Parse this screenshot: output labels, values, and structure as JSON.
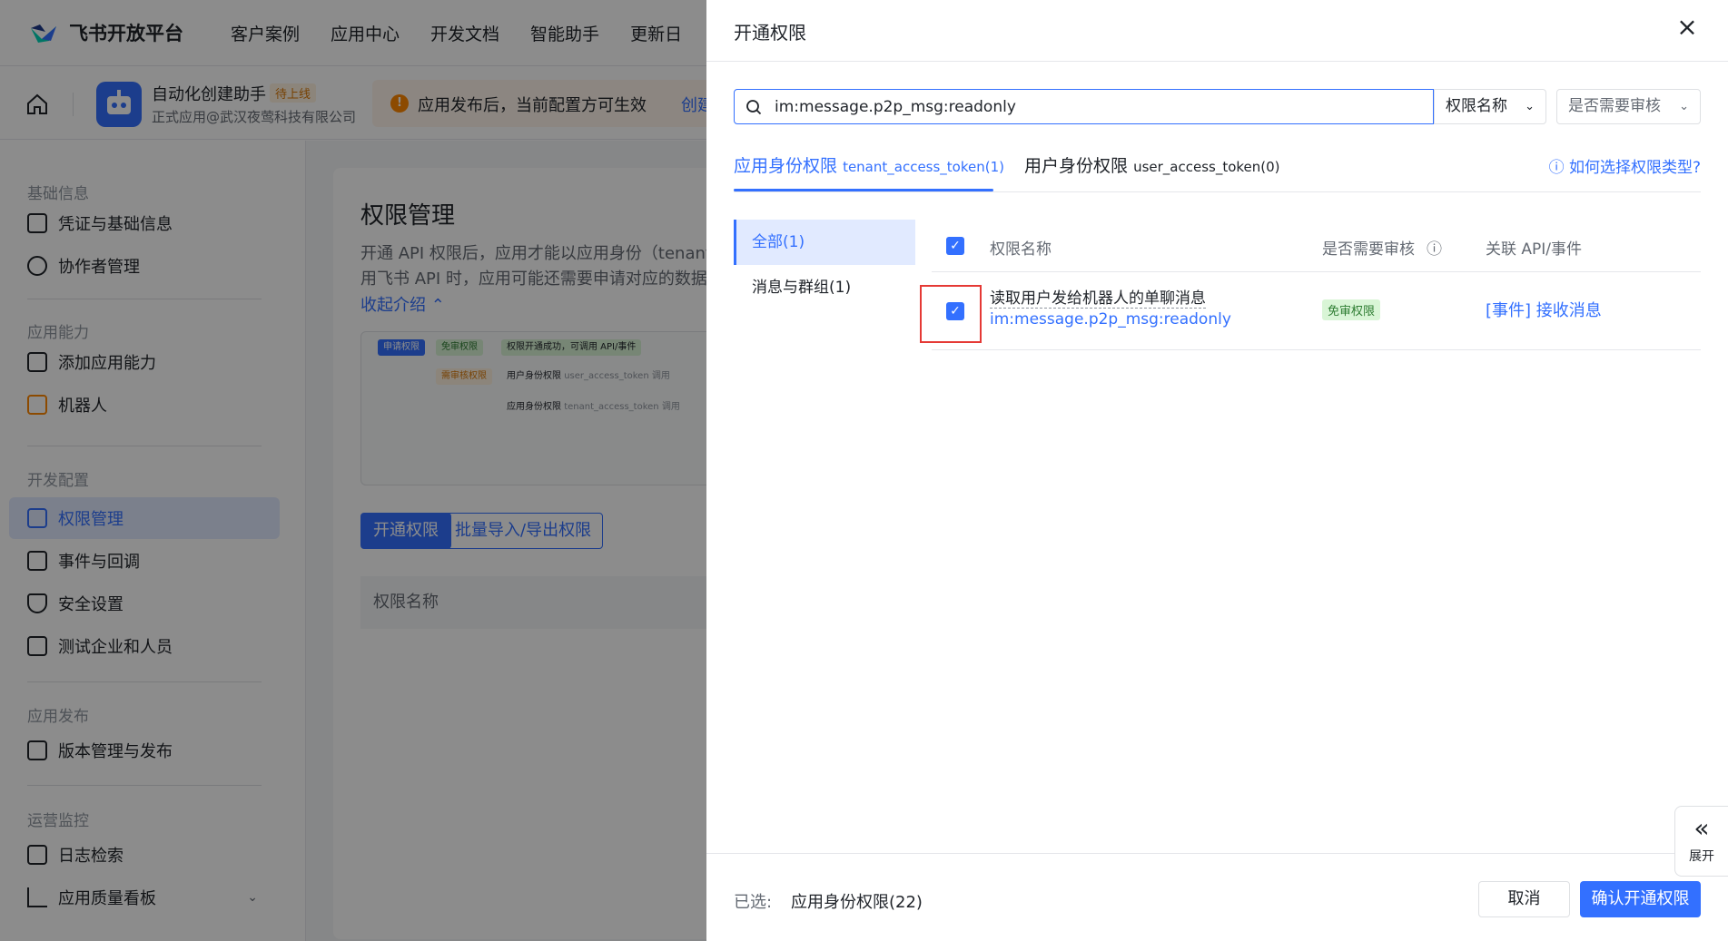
{
  "colors": {
    "accent": "#3370ff",
    "overlay": "rgba(0,0,0,0.45)",
    "alert": "#e53935",
    "free_badge_bg": "#d9f5d6"
  },
  "topnav": {
    "brand": "飞书开放平台",
    "links": [
      "客户案例",
      "应用中心",
      "开发文档",
      "智能助手",
      "更新日"
    ]
  },
  "appbar": {
    "app_name": "自动化创建助手",
    "badge": "待上线",
    "org": "正式应用@武汉夜莺科技有限公司",
    "notice": "应用发布后，当前配置方可生效",
    "notice_link": "创建"
  },
  "sidebar": {
    "groups": [
      {
        "title": "基础信息",
        "items": [
          "凭证与基础信息",
          "协作者管理"
        ]
      },
      {
        "title": "应用能力",
        "items": [
          "添加应用能力",
          "机器人"
        ]
      },
      {
        "title": "开发配置",
        "items": [
          "权限管理",
          "事件与回调",
          "安全设置",
          "测试企业和人员"
        ]
      },
      {
        "title": "应用发布",
        "items": [
          "版本管理与发布"
        ]
      },
      {
        "title": "运营监控",
        "items": [
          "日志检索",
          "应用质量看板"
        ]
      }
    ],
    "active_item": "权限管理"
  },
  "main": {
    "title": "权限管理",
    "desc_line1": "开通 API 权限后，应用才能以应用身份（tenant_a",
    "desc_line2": "用飞书 API 时，应用可能还需要申请对应的数据权",
    "collapse": "收起介绍",
    "flow": {
      "apply": "申请权限",
      "free": "免审权限",
      "success": "权限开通成功，可调用 API/事件",
      "review": "需审核权限",
      "user_perm": "用户身份权限",
      "user_token": "user_access_token 调用",
      "app_perm": "应用身份权限",
      "app_token": "tenant_access_token 调用"
    },
    "btn_open": "开通权限",
    "btn_batch": "批量导入/导出权限",
    "table_head": "权限名称"
  },
  "drawer": {
    "title": "开通权限",
    "close_icon": "close-icon",
    "search_value": "im:message.p2p_msg:readonly",
    "select_name": "权限名称",
    "select_review": "是否需要审核",
    "tabs": [
      {
        "label": "应用身份权限",
        "token": "tenant_access_token(1)",
        "active": true
      },
      {
        "label": "用户身份权限",
        "token": "user_access_token(0)",
        "active": false
      }
    ],
    "help": "如何选择权限类型?",
    "categories": [
      "全部(1)",
      "消息与群组(1)"
    ],
    "columns": {
      "name": "权限名称",
      "review": "是否需要审核",
      "api": "关联 API/事件"
    },
    "rows": [
      {
        "name": "读取用户发给机器人的单聊消息",
        "code": "im:message.p2p_msg:readonly",
        "review": "免审权限",
        "api": "[事件] 接收消息",
        "checked": true
      }
    ],
    "footer": {
      "selected_label": "已选:",
      "selected_value": "应用身份权限(22)",
      "cancel": "取消",
      "confirm": "确认开通权限"
    },
    "expand": {
      "label": "展开"
    }
  }
}
